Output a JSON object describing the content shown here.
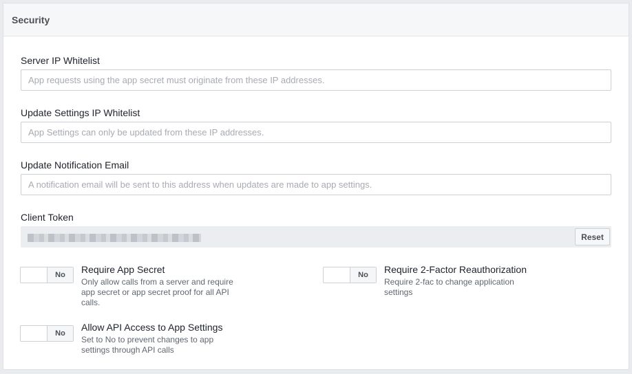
{
  "section": {
    "title": "Security"
  },
  "fields": {
    "server_ip": {
      "label": "Server IP Whitelist",
      "value": "",
      "placeholder": "App requests using the app secret must originate from these IP addresses."
    },
    "settings_ip": {
      "label": "Update Settings IP Whitelist",
      "value": "",
      "placeholder": "App Settings can only be updated from these IP addresses."
    },
    "notify_email": {
      "label": "Update Notification Email",
      "value": "",
      "placeholder": "A notification email will be sent to this address when updates are made to app settings."
    }
  },
  "client_token": {
    "label": "Client Token",
    "reset_label": "Reset"
  },
  "options": {
    "app_secret": {
      "state": "No",
      "title": "Require App Secret",
      "desc_lines": [
        "Only allow calls from a server and require",
        "app secret or app secret proof for all API",
        "calls."
      ]
    },
    "two_factor": {
      "state": "No",
      "title": "Require 2-Factor Reauthorization",
      "desc_lines": [
        "Require 2-fac to change application",
        "settings"
      ]
    },
    "api_access": {
      "state": "No",
      "title": "Allow API Access to App Settings",
      "desc_lines": [
        "Set to No to prevent changes to app",
        "settings through API calls"
      ]
    }
  }
}
